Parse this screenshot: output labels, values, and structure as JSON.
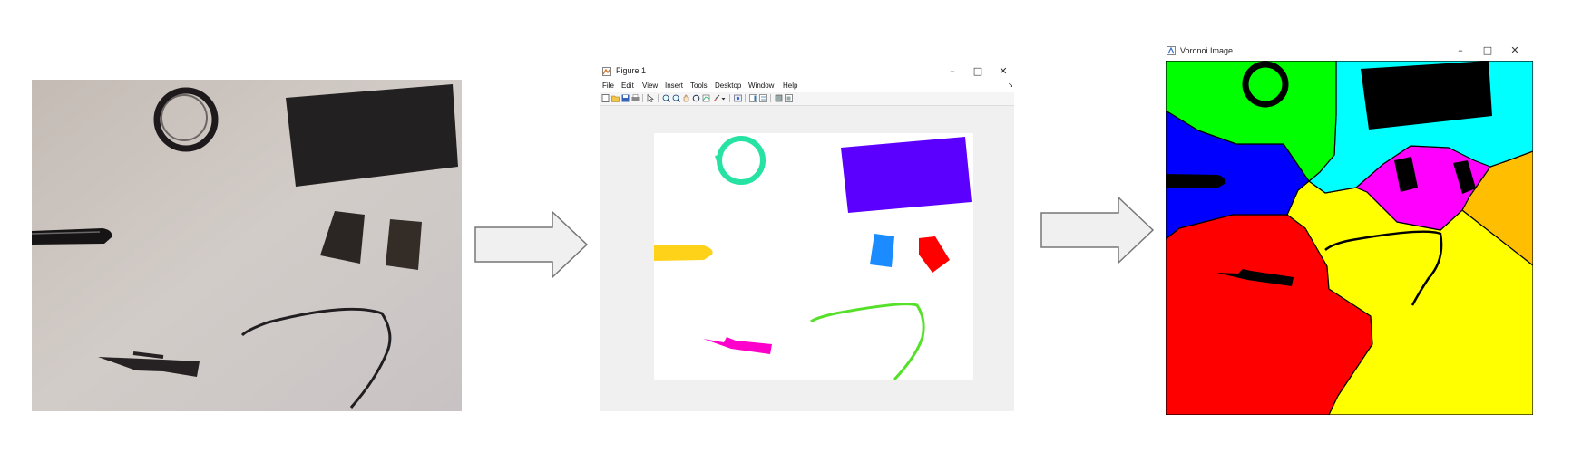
{
  "figure_window": {
    "title": "Figure 1",
    "menu": [
      "File",
      "Edit",
      "View",
      "Insert",
      "Tools",
      "Desktop",
      "Window",
      "Help"
    ],
    "menu_overflow": "↘",
    "controls": {
      "minimize": "–",
      "maximize": "□",
      "close": "✕"
    }
  },
  "voronoi_window": {
    "title": "Voronoi Image",
    "controls": {
      "minimize": "–",
      "maximize": "□",
      "close": "✕"
    }
  },
  "colors": {
    "ring": "#26e3a3",
    "rectangle": "#5b00ff",
    "sd_card_left": "#1a8cff",
    "sd_card_right": "#ff0000",
    "pen_cap": "#ffd21a",
    "pen_clip": "#ff00cc",
    "wire": "#55e02a",
    "region_green": "#00ff00",
    "region_cyan": "#00ffff",
    "region_blue": "#0000ff",
    "region_magenta": "#ff00ff",
    "region_orange": "#ffbf00",
    "region_yellow": "#ffff00",
    "region_red": "#ff0000",
    "arrow_fill": "#f0f0f0",
    "arrow_stroke": "#777777"
  }
}
